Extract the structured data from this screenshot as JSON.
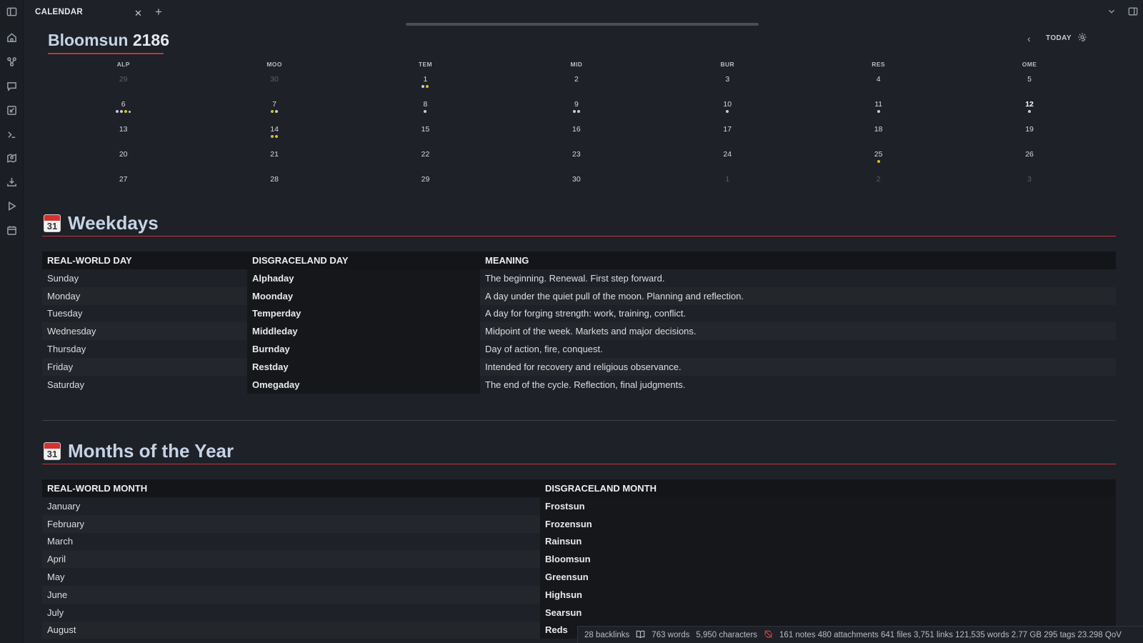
{
  "tab": {
    "title": "CALENDAR"
  },
  "calendar": {
    "month": "Bloomsun",
    "year": "2186",
    "today_label": "TODAY",
    "weekdays": [
      "ALP",
      "MOO",
      "TEM",
      "MID",
      "BUR",
      "RES",
      "OME"
    ],
    "weeks": [
      [
        {
          "d": "29",
          "dim": true,
          "dots": ""
        },
        {
          "d": "30",
          "dim": true,
          "dots": ""
        },
        {
          "d": "1",
          "dots": "wy"
        },
        {
          "d": "2",
          "dots": ""
        },
        {
          "d": "3",
          "dots": ""
        },
        {
          "d": "4",
          "dots": ""
        },
        {
          "d": "5",
          "dots": ""
        }
      ],
      [
        {
          "d": "6",
          "dots": "wwys"
        },
        {
          "d": "7",
          "dots": "yw"
        },
        {
          "d": "8",
          "dots": "w"
        },
        {
          "d": "9",
          "dots": "ww"
        },
        {
          "d": "10",
          "dots": "w"
        },
        {
          "d": "11",
          "dots": "w"
        },
        {
          "d": "12",
          "today": true,
          "dots": "w"
        }
      ],
      [
        {
          "d": "13",
          "dots": ""
        },
        {
          "d": "14",
          "dots": "yy"
        },
        {
          "d": "15",
          "dots": ""
        },
        {
          "d": "16",
          "dots": ""
        },
        {
          "d": "17",
          "dots": ""
        },
        {
          "d": "18",
          "dots": ""
        },
        {
          "d": "19",
          "dots": ""
        }
      ],
      [
        {
          "d": "20",
          "dots": ""
        },
        {
          "d": "21",
          "dots": ""
        },
        {
          "d": "22",
          "dots": ""
        },
        {
          "d": "23",
          "dots": ""
        },
        {
          "d": "24",
          "dots": ""
        },
        {
          "d": "25",
          "dots": "y"
        },
        {
          "d": "26",
          "dots": ""
        }
      ],
      [
        {
          "d": "27",
          "dots": ""
        },
        {
          "d": "28",
          "dots": ""
        },
        {
          "d": "29",
          "dots": ""
        },
        {
          "d": "30",
          "dots": ""
        },
        {
          "d": "1",
          "dim": true,
          "dots": ""
        },
        {
          "d": "2",
          "dim": true,
          "dots": ""
        },
        {
          "d": "3",
          "dim": true,
          "dots": ""
        }
      ]
    ]
  },
  "weekdays_section": {
    "icon_number": "31",
    "title": "Weekdays",
    "headers": [
      "REAL-WORLD DAY",
      "DISGRACELAND DAY",
      "MEANING"
    ],
    "rows": [
      [
        "Sunday",
        "Alphaday",
        "The beginning. Renewal. First step forward."
      ],
      [
        "Monday",
        "Moonday",
        "A day under the quiet pull of the moon. Planning and reflection."
      ],
      [
        "Tuesday",
        "Temperday",
        "A day for forging strength: work, training, conflict."
      ],
      [
        "Wednesday",
        "Middleday",
        "Midpoint of the week. Markets and major decisions."
      ],
      [
        "Thursday",
        "Burnday",
        "Day of action, fire, conquest."
      ],
      [
        "Friday",
        "Restday",
        "Intended for recovery and religious observance."
      ],
      [
        "Saturday",
        "Omegaday",
        "The end of the cycle. Reflection, final judgments."
      ]
    ]
  },
  "months_section": {
    "icon_number": "31",
    "title": "Months of the Year",
    "headers": [
      "REAL-WORLD MONTH",
      "DISGRACELAND MONTH"
    ],
    "rows": [
      [
        "January",
        "Frostsun"
      ],
      [
        "February",
        "Frozensun"
      ],
      [
        "March",
        "Rainsun"
      ],
      [
        "April",
        "Bloomsun"
      ],
      [
        "May",
        "Greensun"
      ],
      [
        "June",
        "Highsun"
      ],
      [
        "July",
        "Searsun"
      ],
      [
        "August",
        "Reds"
      ]
    ]
  },
  "status": {
    "backlinks": "28 backlinks",
    "words": "763 words",
    "characters": "5,950 characters",
    "vault_stats": "161 notes 480 attachments 641 files 3,751 links 121,535 words 2.77 GB 295 tags 23.298 QoV"
  }
}
